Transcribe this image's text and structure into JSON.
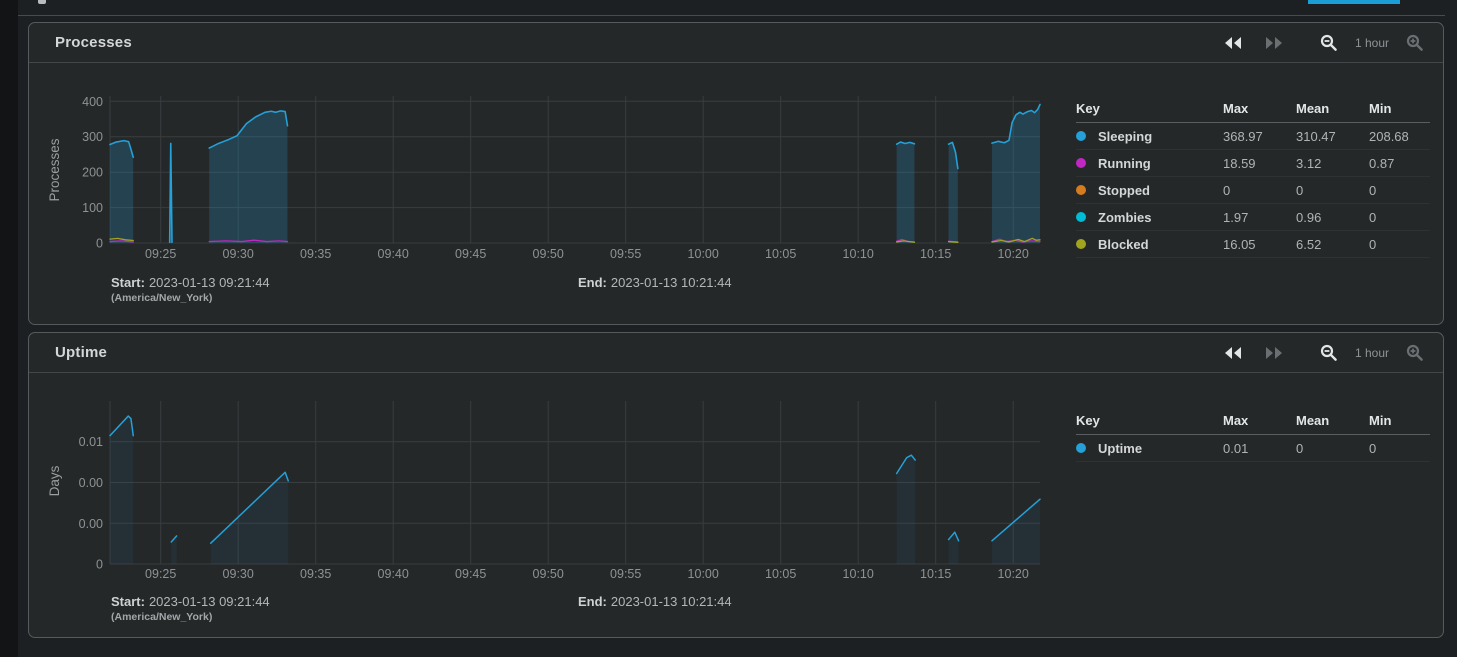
{
  "page": {
    "primary_button_color": "#1b9ed6"
  },
  "panels": [
    {
      "title": "Processes",
      "controls": {
        "range_label": "1 hour"
      },
      "meta": {
        "start_label": "Start:",
        "start_value": "2023-01-13 09:21:44",
        "timezone": "(America/New_York)",
        "end_label": "End:",
        "end_value": "2023-01-13 10:21:44"
      },
      "legend": {
        "headers": [
          "Key",
          "Max",
          "Mean",
          "Min"
        ],
        "rows": [
          {
            "label": "Sleeping",
            "color": "#25a0d8",
            "max": "368.97",
            "mean": "310.47",
            "min": "208.68"
          },
          {
            "label": "Running",
            "color": "#c127c1",
            "max": "18.59",
            "mean": "3.12",
            "min": "0.87"
          },
          {
            "label": "Stopped",
            "color": "#d57d1e",
            "max": "0",
            "mean": "0",
            "min": "0"
          },
          {
            "label": "Zombies",
            "color": "#00bcd4",
            "max": "1.97",
            "mean": "0.96",
            "min": "0"
          },
          {
            "label": "Blocked",
            "color": "#a2a41e",
            "max": "16.05",
            "mean": "6.52",
            "min": "0"
          }
        ]
      },
      "chart_data": {
        "type": "area",
        "title": "Processes",
        "ylabel": "Processes",
        "xlabel": "",
        "grid": true,
        "legend_position": "right-table",
        "x_window": [
          "09:21:44",
          "10:21:44"
        ],
        "xlim_minutes": [
          0,
          60
        ],
        "ylim": [
          0,
          415
        ],
        "x_ticks": [
          {
            "t": 3.27,
            "label": "09:25"
          },
          {
            "t": 8.27,
            "label": "09:30"
          },
          {
            "t": 13.27,
            "label": "09:35"
          },
          {
            "t": 18.27,
            "label": "09:40"
          },
          {
            "t": 23.27,
            "label": "09:45"
          },
          {
            "t": 28.27,
            "label": "09:50"
          },
          {
            "t": 33.27,
            "label": "09:55"
          },
          {
            "t": 38.27,
            "label": "10:00"
          },
          {
            "t": 43.27,
            "label": "10:05"
          },
          {
            "t": 48.27,
            "label": "10:10"
          },
          {
            "t": 53.27,
            "label": "10:15"
          },
          {
            "t": 58.27,
            "label": "10:20"
          }
        ],
        "y_ticks": [
          {
            "v": 0,
            "label": "0"
          },
          {
            "v": 100,
            "label": "100"
          },
          {
            "v": 200,
            "label": "200"
          },
          {
            "v": 300,
            "label": "300"
          },
          {
            "v": 400,
            "label": "400"
          }
        ],
        "series": [
          {
            "name": "Sleeping",
            "color": "#25a0d8",
            "stroke_width": 1.6,
            "fill_opacity": 0.22,
            "segments": [
              [
                [
                  0,
                  278
                ],
                [
                  0.4,
                  285
                ],
                [
                  0.9,
                  289
                ],
                [
                  1.2,
                  286
                ],
                [
                  1.35,
                  265
                ],
                [
                  1.5,
                  242
                ]
              ],
              [
                [
                  3.85,
                  2
                ],
                [
                  3.92,
                  281
                ],
                [
                  4.0,
                  2
                ]
              ],
              [
                [
                  6.4,
                  268
                ],
                [
                  7.0,
                  281
                ],
                [
                  7.3,
                  286
                ],
                [
                  7.6,
                  291
                ],
                [
                  8.2,
                  303
                ],
                [
                  8.8,
                  337
                ],
                [
                  9.4,
                  356
                ],
                [
                  10.0,
                  369
                ],
                [
                  10.4,
                  372
                ],
                [
                  10.7,
                  369
                ],
                [
                  11.0,
                  373
                ],
                [
                  11.3,
                  371
                ],
                [
                  11.45,
                  331
                ]
              ],
              [
                [
                  50.75,
                  279
                ],
                [
                  51.0,
                  285
                ],
                [
                  51.3,
                  281
                ],
                [
                  51.6,
                  284
                ],
                [
                  51.9,
                  280
                ]
              ],
              [
                [
                  54.1,
                  279
                ],
                [
                  54.35,
                  284
                ],
                [
                  54.55,
                  256
                ],
                [
                  54.7,
                  210
                ]
              ],
              [
                [
                  56.9,
                  282
                ],
                [
                  57.3,
                  287
                ],
                [
                  57.7,
                  283
                ],
                [
                  58.0,
                  290
                ],
                [
                  58.2,
                  340
                ],
                [
                  58.45,
                  362
                ],
                [
                  58.7,
                  369
                ],
                [
                  58.9,
                  364
                ],
                [
                  59.2,
                  371
                ],
                [
                  59.45,
                  374
                ],
                [
                  59.65,
                  368
                ],
                [
                  59.85,
                  377
                ],
                [
                  60,
                  391
                ]
              ]
            ]
          },
          {
            "name": "Running",
            "color": "#c127c1",
            "stroke_width": 1.3,
            "fill_opacity": 0,
            "segments": [
              [
                [
                  0,
                  4
                ],
                [
                  0.7,
                  6
                ],
                [
                  1.5,
                  3
                ]
              ],
              [
                [
                  6.4,
                  4
                ],
                [
                  7.5,
                  6
                ],
                [
                  8.5,
                  4
                ],
                [
                  9.3,
                  8
                ],
                [
                  10.1,
                  4
                ],
                [
                  10.9,
                  6
                ],
                [
                  11.45,
                  4
                ]
              ],
              [
                [
                  50.75,
                  5
                ],
                [
                  51.1,
                  10
                ],
                [
                  51.5,
                  4
                ],
                [
                  51.9,
                  3
                ]
              ],
              [
                [
                  54.1,
                  5
                ],
                [
                  54.7,
                  3
                ]
              ],
              [
                [
                  56.9,
                  4
                ],
                [
                  57.4,
                  11
                ],
                [
                  57.8,
                  4
                ],
                [
                  58.4,
                  7
                ],
                [
                  58.9,
                  3
                ],
                [
                  59.4,
                  6
                ],
                [
                  60,
                  4
                ]
              ]
            ]
          },
          {
            "name": "Stopped",
            "color": "#d57d1e",
            "stroke_width": 1.3,
            "fill_opacity": 0,
            "segments": []
          },
          {
            "name": "Zombies",
            "color": "#00bcd4",
            "stroke_width": 1.3,
            "fill_opacity": 0,
            "segments": []
          },
          {
            "name": "Blocked",
            "color": "#a2a41e",
            "stroke_width": 1.3,
            "fill_opacity": 0,
            "segments": [
              [
                [
                  0,
                  11
                ],
                [
                  0.5,
                  13
                ],
                [
                  1.0,
                  9
                ],
                [
                  1.5,
                  7
                ]
              ],
              [
                [
                  50.75,
                  3
                ],
                [
                  51.2,
                  6
                ],
                [
                  51.9,
                  2
                ]
              ],
              [
                [
                  54.1,
                  4
                ],
                [
                  54.7,
                  2
                ]
              ],
              [
                [
                  56.9,
                  3
                ],
                [
                  57.5,
                  7
                ],
                [
                  58.0,
                  3
                ],
                [
                  58.6,
                  10
                ],
                [
                  59.0,
                  4
                ],
                [
                  59.5,
                  13
                ],
                [
                  59.75,
                  8
                ],
                [
                  60,
                  9
                ]
              ]
            ]
          }
        ]
      }
    },
    {
      "title": "Uptime",
      "controls": {
        "range_label": "1 hour"
      },
      "meta": {
        "start_label": "Start:",
        "start_value": "2023-01-13 09:21:44",
        "timezone": "(America/New_York)",
        "end_label": "End:",
        "end_value": "2023-01-13 10:21:44"
      },
      "legend": {
        "headers": [
          "Key",
          "Max",
          "Mean",
          "Min"
        ],
        "rows": [
          {
            "label": "Uptime",
            "color": "#25a0d8",
            "max": "0.01",
            "mean": "0",
            "min": "0"
          }
        ]
      },
      "chart_data": {
        "type": "line",
        "title": "Uptime",
        "ylabel": "Days",
        "xlabel": "",
        "grid": true,
        "legend_position": "right-table",
        "x_window": [
          "09:21:44",
          "10:21:44"
        ],
        "xlim_minutes": [
          0,
          60
        ],
        "ylim": [
          0,
          0.013333
        ],
        "x_ticks": [
          {
            "t": 3.27,
            "label": "09:25"
          },
          {
            "t": 8.27,
            "label": "09:30"
          },
          {
            "t": 13.27,
            "label": "09:35"
          },
          {
            "t": 18.27,
            "label": "09:40"
          },
          {
            "t": 23.27,
            "label": "09:45"
          },
          {
            "t": 28.27,
            "label": "09:50"
          },
          {
            "t": 33.27,
            "label": "09:55"
          },
          {
            "t": 38.27,
            "label": "10:00"
          },
          {
            "t": 43.27,
            "label": "10:05"
          },
          {
            "t": 48.27,
            "label": "10:10"
          },
          {
            "t": 53.27,
            "label": "10:15"
          },
          {
            "t": 58.27,
            "label": "10:20"
          }
        ],
        "y_ticks": [
          {
            "v": 0,
            "label": "0"
          },
          {
            "v": 0.003333,
            "label": "0.00"
          },
          {
            "v": 0.006667,
            "label": "0.00"
          },
          {
            "v": 0.01,
            "label": "0.01"
          }
        ],
        "series": [
          {
            "name": "Uptime",
            "color": "#25a0d8",
            "stroke_width": 1.5,
            "fill_opacity": 0.07,
            "segments": [
              [
                [
                  0,
                  0.0105
                ],
                [
                  1.18,
                  0.0121
                ],
                [
                  1.35,
                  0.0119
                ],
                [
                  1.5,
                  0.0105
                ]
              ],
              [
                [
                  3.95,
                  0.0018
                ],
                [
                  4.3,
                  0.0023
                ]
              ],
              [
                [
                  6.5,
                  0.0017
                ],
                [
                  11.3,
                  0.0075
                ],
                [
                  11.5,
                  0.0068
                ]
              ],
              [
                [
                  50.75,
                  0.0074
                ],
                [
                  51.4,
                  0.0087
                ],
                [
                  51.7,
                  0.0089
                ],
                [
                  51.95,
                  0.0085
                ]
              ],
              [
                [
                  54.1,
                  0.002
                ],
                [
                  54.5,
                  0.0026
                ],
                [
                  54.75,
                  0.0019
                ]
              ],
              [
                [
                  56.9,
                  0.0019
                ],
                [
                  60,
                  0.0053
                ]
              ]
            ]
          }
        ]
      }
    }
  ]
}
